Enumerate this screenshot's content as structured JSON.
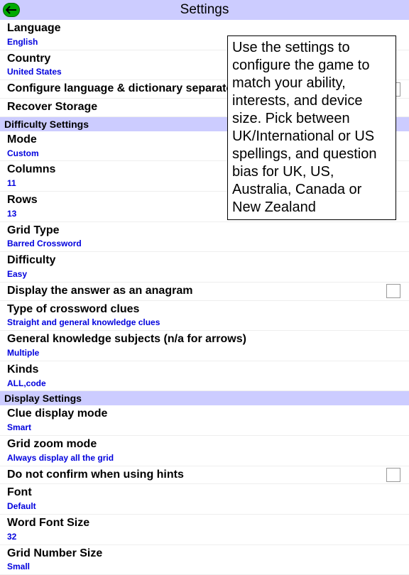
{
  "header": {
    "title": "Settings"
  },
  "tooltip": "Use the settings to configure the game to match your ability, interests, and device size. Pick between UK/International or US spellings, and question bias for UK, US, Australia, Canada or New Zealand",
  "general": [
    {
      "label": "Language",
      "value": "English"
    },
    {
      "label": "Country",
      "value": "United States"
    },
    {
      "label": "Configure language & dictionary separately",
      "checkbox": true
    },
    {
      "label": "Recover Storage"
    }
  ],
  "sections": [
    {
      "title": "Difficulty Settings",
      "rows": [
        {
          "label": "Mode",
          "value": "Custom"
        },
        {
          "label": "Columns",
          "value": "11"
        },
        {
          "label": "Rows",
          "value": "13"
        },
        {
          "label": "Grid Type",
          "value": "Barred Crossword"
        },
        {
          "label": "Difficulty",
          "value": "Easy"
        },
        {
          "label": "Display the answer as an anagram",
          "checkbox": true
        },
        {
          "label": "Type of crossword clues",
          "value": "Straight and general knowledge clues"
        },
        {
          "label": "General knowledge subjects (n/a for arrows)",
          "value": "Multiple"
        },
        {
          "label": "Kinds",
          "value": "ALL,code"
        }
      ]
    },
    {
      "title": "Display Settings",
      "rows": [
        {
          "label": "Clue display mode",
          "value": "Smart"
        },
        {
          "label": "Grid zoom mode",
          "value": "Always display all the grid"
        },
        {
          "label": "Do not confirm when using hints",
          "checkbox": true
        },
        {
          "label": "Font",
          "value": "Default"
        },
        {
          "label": "Word Font Size",
          "value": "32"
        },
        {
          "label": "Grid Number Size",
          "value": "Small"
        }
      ]
    }
  ]
}
